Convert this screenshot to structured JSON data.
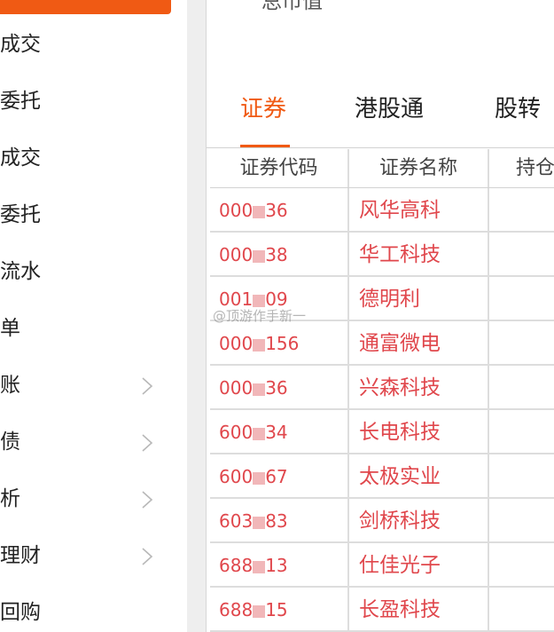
{
  "sidebar": {
    "items": [
      {
        "label": "成交",
        "chevron": false
      },
      {
        "label": "委托",
        "chevron": false
      },
      {
        "label": "成交",
        "chevron": false
      },
      {
        "label": "委托",
        "chevron": false
      },
      {
        "label": "流水",
        "chevron": false
      },
      {
        "label": "单",
        "chevron": false
      },
      {
        "label": "账",
        "chevron": true
      },
      {
        "label": "债",
        "chevron": true
      },
      {
        "label": "析",
        "chevron": true
      },
      {
        "label": "理财",
        "chevron": true
      },
      {
        "label": "回购",
        "chevron": false
      }
    ],
    "accent_color": "#f05a14"
  },
  "main": {
    "total_label": "总市值",
    "tabs": [
      {
        "label": "证券",
        "active": true
      },
      {
        "label": "港股通",
        "active": false
      },
      {
        "label": "股转",
        "active": false
      }
    ],
    "table": {
      "headers": {
        "code": "证券代码",
        "name": "证券名称",
        "hold": "持仓"
      },
      "rows": [
        {
          "code": [
            "000",
            "36"
          ],
          "name": [
            "风华",
            "高科"
          ]
        },
        {
          "code": [
            "000",
            "38"
          ],
          "name": [
            "华工",
            "科技"
          ]
        },
        {
          "code": [
            "001",
            "09"
          ],
          "name": [
            "德明",
            "利"
          ]
        },
        {
          "code": [
            "000",
            "156"
          ],
          "name": [
            "通富",
            "微电"
          ]
        },
        {
          "code": [
            "000",
            "36"
          ],
          "name": [
            "兴森",
            "科技"
          ]
        },
        {
          "code": [
            "600",
            "34"
          ],
          "name": [
            "长电",
            "科技"
          ]
        },
        {
          "code": [
            "600",
            "67"
          ],
          "name": [
            "太极",
            "实业"
          ]
        },
        {
          "code": [
            "603",
            "83"
          ],
          "name": [
            "剑桥",
            "科技"
          ]
        },
        {
          "code": [
            "688",
            "13"
          ],
          "name": [
            "仕佳",
            "光子"
          ]
        },
        {
          "code": [
            "688",
            "15"
          ],
          "name": [
            "长盈",
            "科技"
          ]
        }
      ],
      "text_color": "#e0474c"
    }
  },
  "watermark": "@顶游作手新一"
}
